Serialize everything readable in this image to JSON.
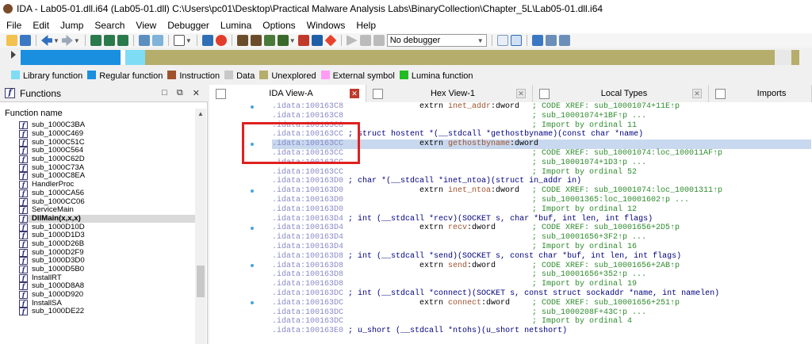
{
  "window": {
    "title": "IDA - Lab05-01.dll.i64 (Lab05-01.dll) C:\\Users\\pc01\\Desktop\\Practical Malware Analysis Labs\\BinaryCollection\\Chapter_5L\\Lab05-01.dll.i64"
  },
  "menu": [
    "File",
    "Edit",
    "Jump",
    "Search",
    "View",
    "Debugger",
    "Lumina",
    "Options",
    "Windows",
    "Help"
  ],
  "toolbar": {
    "debugger_select": "No debugger"
  },
  "navband": {
    "segments": [
      {
        "color": "#1a8fe0",
        "weight": 12.8
      },
      {
        "color": "#ffffff",
        "weight": 0.6
      },
      {
        "color": "#7fdcf5",
        "weight": 2.6
      },
      {
        "color": "#b5ad6b",
        "weight": 80.8
      },
      {
        "color": "#e8e8e8",
        "weight": 2.2
      },
      {
        "color": "#b5ad6b",
        "weight": 1.0
      }
    ]
  },
  "legend": [
    {
      "label": "Library function",
      "color": "#7fdcf5"
    },
    {
      "label": "Regular function",
      "color": "#1a8fe0"
    },
    {
      "label": "Instruction",
      "color": "#a0522d"
    },
    {
      "label": "Data",
      "color": "#c8c8c8"
    },
    {
      "label": "Unexplored",
      "color": "#b5ad6b"
    },
    {
      "label": "External symbol",
      "color": "#ff9cf5"
    },
    {
      "label": "Lumina function",
      "color": "#22bb22"
    }
  ],
  "functions_panel": {
    "title": "Functions",
    "column_header": "Function name",
    "items": [
      "sub_1000C3BA",
      "sub_1000C469",
      "sub_1000C51C",
      "sub_1000C564",
      "sub_1000C62D",
      "sub_1000C73A",
      "sub_1000C8EA",
      "HandlerProc",
      "sub_1000CA56",
      "sub_1000CC06",
      "ServiceMain",
      "DllMain(x,x,x)",
      "sub_1000D10D",
      "sub_1000D1D3",
      "sub_1000D26B",
      "sub_1000D2F9",
      "sub_1000D3D0",
      "sub_1000D5B0",
      "InstallRT",
      "sub_1000D8A8",
      "sub_1000D920",
      "InstallSA",
      "sub_1000DE22"
    ],
    "selected_index": 11
  },
  "tabs": [
    {
      "label": "IDA View-A",
      "active": true
    },
    {
      "label": "Hex View-1",
      "active": false
    },
    {
      "label": "Local Types",
      "active": false
    },
    {
      "label": "Imports",
      "active": false
    }
  ],
  "code": {
    "lines": [
      {
        "addr": ".idata:100163C8",
        "instr": "extrn inet_addr:dword",
        "name": "inet_addr",
        "comment": "; CODE XREF: sub_10001074+11E↑p",
        "dot": true
      },
      {
        "addr": ".idata:100163C8",
        "instr": "",
        "comment": "; sub_10001074+1BF↑p ..."
      },
      {
        "addr": ".idata:100163C8",
        "instr": "",
        "comment": "; Import by ordinal 11"
      },
      {
        "addr": ".idata:100163CC",
        "proto": "; struct hostent *(__stdcall *gethostbyname)(const char *name)"
      },
      {
        "addr": ".idata:100163CC",
        "instr": "extrn gethostbyname:dword",
        "name": "gethostbyname",
        "comment": "",
        "dot": true,
        "hl": true
      },
      {
        "addr": ".idata:100163CC",
        "instr": "",
        "comment": "; CODE XREF: sub_10001074:loc_100011AF↑p"
      },
      {
        "addr": ".idata:100163CC",
        "instr": "",
        "comment": "; sub_10001074+1D3↑p ..."
      },
      {
        "addr": ".idata:100163CC",
        "instr": "",
        "comment": "; Import by ordinal 52"
      },
      {
        "addr": ".idata:100163D0",
        "proto": "; char *(__stdcall *inet_ntoa)(struct in_addr in)"
      },
      {
        "addr": ".idata:100163D0",
        "instr": "extrn inet_ntoa:dword",
        "name": "inet_ntoa",
        "comment": "; CODE XREF: sub_10001074:loc_10001311↑p",
        "dot": true
      },
      {
        "addr": ".idata:100163D0",
        "instr": "",
        "comment": "; sub_10001365:loc_10001602↑p ..."
      },
      {
        "addr": ".idata:100163D0",
        "instr": "",
        "comment": "; Import by ordinal 12"
      },
      {
        "addr": ".idata:100163D4",
        "proto": "; int (__stdcall *recv)(SOCKET s, char *buf, int len, int flags)"
      },
      {
        "addr": ".idata:100163D4",
        "instr": "extrn recv:dword",
        "name": "recv",
        "comment": "; CODE XREF: sub_10001656+2D5↑p",
        "dot": true
      },
      {
        "addr": ".idata:100163D4",
        "instr": "",
        "comment": "; sub_10001656+3F2↑p ..."
      },
      {
        "addr": ".idata:100163D4",
        "instr": "",
        "comment": "; Import by ordinal 16"
      },
      {
        "addr": ".idata:100163D8",
        "proto": "; int (__stdcall *send)(SOCKET s, const char *buf, int len, int flags)"
      },
      {
        "addr": ".idata:100163D8",
        "instr": "extrn send:dword",
        "name": "send",
        "comment": "; CODE XREF: sub_10001656+2AB↑p",
        "dot": true
      },
      {
        "addr": ".idata:100163D8",
        "instr": "",
        "comment": "; sub_10001656+352↑p ..."
      },
      {
        "addr": ".idata:100163D8",
        "instr": "",
        "comment": "; Import by ordinal 19"
      },
      {
        "addr": ".idata:100163DC",
        "proto": "; int (__stdcall *connect)(SOCKET s, const struct sockaddr *name, int namelen)"
      },
      {
        "addr": ".idata:100163DC",
        "instr": "extrn connect:dword",
        "name": "connect",
        "comment": "; CODE XREF: sub_10001656+251↑p",
        "dot": true
      },
      {
        "addr": ".idata:100163DC",
        "instr": "",
        "comment": "; sub_1000208F+43C↑p ..."
      },
      {
        "addr": ".idata:100163DC",
        "instr": "",
        "comment": "; Import by ordinal 4"
      },
      {
        "addr": ".idata:100163E0",
        "proto": "; u_short (__stdcall *ntohs)(u_short netshort)"
      }
    ]
  },
  "colors": {
    "highlight_box": "#e02020",
    "address": "#8a8ac8",
    "comment": "#2e8b2e",
    "import_name": "#a0522d"
  }
}
